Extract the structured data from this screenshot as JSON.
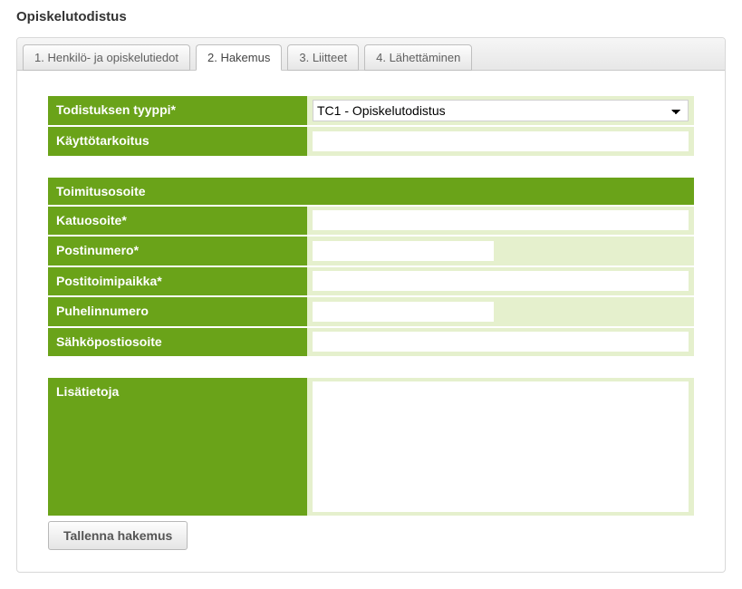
{
  "page_title": "Opiskelutodistus",
  "tabs": [
    {
      "label": "1. Henkilö- ja opiskelutiedot",
      "active": false
    },
    {
      "label": "2. Hakemus",
      "active": true
    },
    {
      "label": "3. Liitteet",
      "active": false
    },
    {
      "label": "4. Lähettäminen",
      "active": false
    }
  ],
  "form": {
    "todistuksen_tyyppi_label": "Todistuksen tyyppi*",
    "todistuksen_tyyppi_value": "TC1 - Opiskelutodistus",
    "kayttotarkoitus_label": "Käyttötarkoitus",
    "kayttotarkoitus_value": "",
    "toimitusosoite_header": "Toimitusosoite",
    "katuosoite_label": "Katuosoite*",
    "katuosoite_value": "",
    "postinumero_label": "Postinumero*",
    "postinumero_value": "",
    "postitoimipaikka_label": "Postitoimipaikka*",
    "postitoimipaikka_value": "",
    "puhelinnumero_label": "Puhelinnumero",
    "puhelinnumero_value": "",
    "sahkopostiosoite_label": "Sähköpostiosoite",
    "sahkopostiosoite_value": "",
    "lisatietoja_label": "Lisätietoja",
    "lisatietoja_value": ""
  },
  "buttons": {
    "tallenna_hakemus": "Tallenna hakemus"
  }
}
